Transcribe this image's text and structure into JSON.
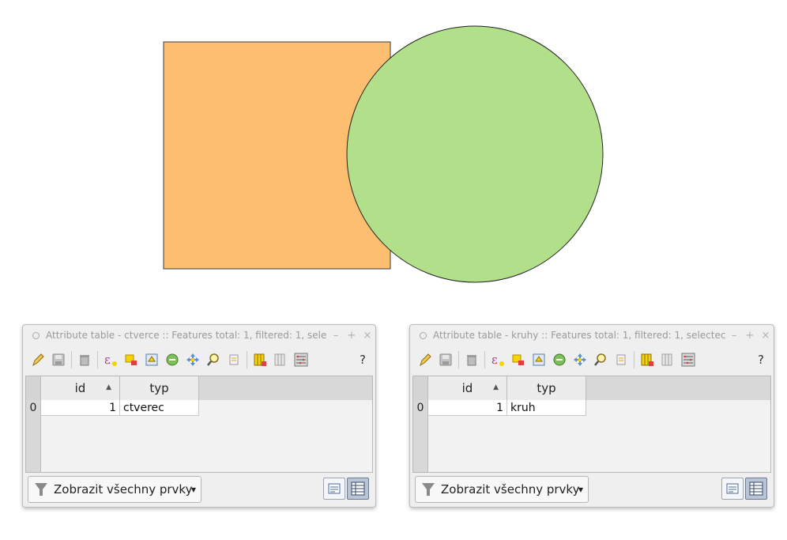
{
  "canvas": {
    "square": {
      "fill": "#fdbf6f",
      "stroke": "#3b3b3b"
    },
    "circle": {
      "fill": "#b2df8a",
      "stroke": "#222222"
    }
  },
  "windows": [
    {
      "title": "Attribute table - ctverce :: Features total: 1, filtered: 1, sele",
      "columns": [
        "id",
        "typ"
      ],
      "rows": [
        {
          "row_number": "0",
          "id": "1",
          "typ": "ctverec"
        }
      ],
      "filter_label": "Zobrazit všechny prvky",
      "help_label": "?"
    },
    {
      "title": "Attribute table - kruhy :: Features total: 1, filtered: 1, selectec",
      "columns": [
        "id",
        "typ"
      ],
      "rows": [
        {
          "row_number": "0",
          "id": "1",
          "typ": "kruh"
        }
      ],
      "filter_label": "Zobrazit všechny prvky",
      "help_label": "?"
    }
  ],
  "icons": {
    "window_controls": [
      "minimize-icon",
      "pin-icon",
      "close-icon"
    ],
    "toolbar": [
      "pencil-icon",
      "save-icon",
      "delete-icon",
      "expression-select-icon",
      "select-all-icon",
      "invert-selection-icon",
      "deselect-icon",
      "filter-move-top-icon",
      "pan-to-selection-icon",
      "zoom-to-selection-icon",
      "copy-icon",
      "paste-icon",
      "new-column-icon",
      "delete-column-icon",
      "field-calculator-icon"
    ]
  }
}
